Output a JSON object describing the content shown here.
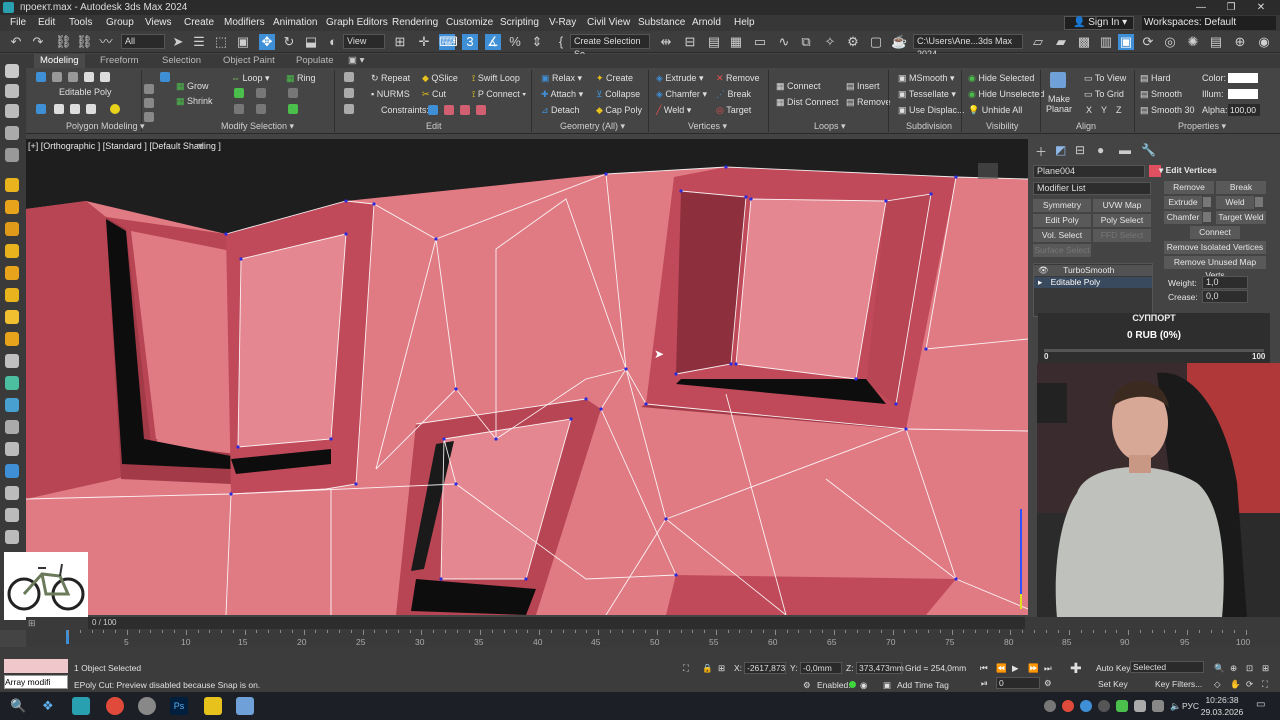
{
  "window": {
    "title": "проект.max - Autodesk 3ds Max 2024"
  },
  "menu": [
    "File",
    "Edit",
    "Tools",
    "Group",
    "Views",
    "Create",
    "Modifiers",
    "Animation",
    "Graph Editors",
    "Rendering",
    "Customize",
    "Scripting",
    "V-Ray",
    "Civil View",
    "Substance",
    "Arnold",
    "Help"
  ],
  "account": {
    "signin": "Sign In",
    "workspaces_label": "Workspaces:",
    "workspace": "Default"
  },
  "toolbar": {
    "filter": "All",
    "view": "View",
    "selection_set": "Create Selection Se",
    "path": "C:\\Users\\Ane...3ds Max 2024"
  },
  "ribbon_tabs": [
    "Modeling",
    "Freeform",
    "Selection",
    "Object Paint",
    "Populate"
  ],
  "ribbon": {
    "editable_poly": "Editable Poly",
    "grow": "Grow",
    "shrink": "Shrink",
    "loop": "Loop",
    "ring": "Ring",
    "repeat": "Repeat",
    "qslice": "QSlice",
    "swift_loop": "Swift Loop",
    "nurms": "NURMS",
    "cut": "Cut",
    "p_connect": "P Connect",
    "constraints": "Constraints:",
    "relax": "Relax",
    "create": "Create",
    "attach": "Attach",
    "collapse": "Collapse",
    "detach": "Detach",
    "cap_poly": "Cap Poly",
    "extrude": "Extrude",
    "remove": "Remove",
    "chamfer": "Chamfer",
    "break": "Break",
    "weld": "Weld",
    "target": "Target",
    "connect": "Connect",
    "insert": "Insert",
    "dist_connect": "Dist Connect",
    "remove2": "Remove",
    "msmooth": "MSmooth",
    "tessellate": "Tessellate",
    "use_displac": "Use Displac...",
    "hide_selected": "Hide Selected",
    "hide_unselected": "Hide Unselected",
    "unhide_all": "Unhide All",
    "make_planar": "Make Planar",
    "to_view": "To View",
    "to_grid": "To Grid",
    "x": "X",
    "y": "Y",
    "z": "Z",
    "hard": "Hard",
    "smooth": "Smooth",
    "smooth30": "Smooth 30",
    "color": "Color:",
    "illum": "Illum:",
    "alpha": "Alpha:",
    "alpha_value": "100,00",
    "groups": [
      "Polygon Modeling ▾",
      "Modify Selection ▾",
      "Edit",
      "Geometry (All) ▾",
      "Vertices ▾",
      "Loops ▾",
      "Subdivision",
      "Visibility",
      "Align",
      "Properties ▾"
    ]
  },
  "viewport": {
    "label": "[+] [Orthographic ] [Standard ] [Default Shading ]"
  },
  "command_panel": {
    "object_name": "Plane004",
    "modifier_list": "Modifier List",
    "buttons": [
      "Symmetry",
      "UVW Map",
      "Edit Poly",
      "Poly Select",
      "Vol. Select",
      "FFD Select",
      "Surface Select"
    ],
    "stack": [
      "TurboSmooth",
      "Editable Poly"
    ],
    "edit_vertices": {
      "title": "Edit Vertices",
      "remove": "Remove",
      "break": "Break",
      "extrude": "Extrude",
      "weld": "Weld",
      "chamfer": "Chamfer",
      "target_weld": "Target Weld",
      "connect": "Connect",
      "remove_isolated": "Remove Isolated Vertices",
      "remove_unused": "Remove Unused Map Verts",
      "weight_label": "Weight:",
      "weight": "1,0",
      "crease_label": "Crease:",
      "crease": "0,0"
    }
  },
  "support": {
    "title": "СУППОРТ",
    "amount": "0 RUB (0%)",
    "min": "0",
    "max": "100",
    "progress": 0
  },
  "timeline": {
    "position": "0 / 100",
    "ticks": [
      "5",
      "10",
      "15",
      "20",
      "25",
      "30",
      "35",
      "40",
      "45",
      "50",
      "55",
      "60",
      "65",
      "70",
      "75",
      "80",
      "85",
      "90",
      "95",
      "100"
    ]
  },
  "status": {
    "thumb_label": "Array modifi",
    "selected": "1 Object Selected",
    "prompt": "EPoly Cut: Preview disabled because Snap is on.",
    "x_label": "X:",
    "x": "-2617,873",
    "y_label": "Y:",
    "y": "-0,0mm",
    "z_label": "Z:",
    "z": "373,473mm",
    "grid": "Grid = 254,0mm",
    "enabled": "Enabled:",
    "add_time_tag": "Add Time Tag",
    "auto_key": "Auto Key",
    "set_key": "Set Key",
    "key_mode": "Selected",
    "key_filters": "Key Filters...",
    "frame": "0"
  },
  "taskbar": {
    "time": "10:26:38",
    "date": "29.03.2026",
    "lang": "РУС"
  },
  "colors": {
    "mesh": "#e07b84",
    "mesh_dark": "#a33a48",
    "wire": "#ffffff",
    "vertex": "#2a2ae0",
    "accent": "#3f8fd6"
  }
}
